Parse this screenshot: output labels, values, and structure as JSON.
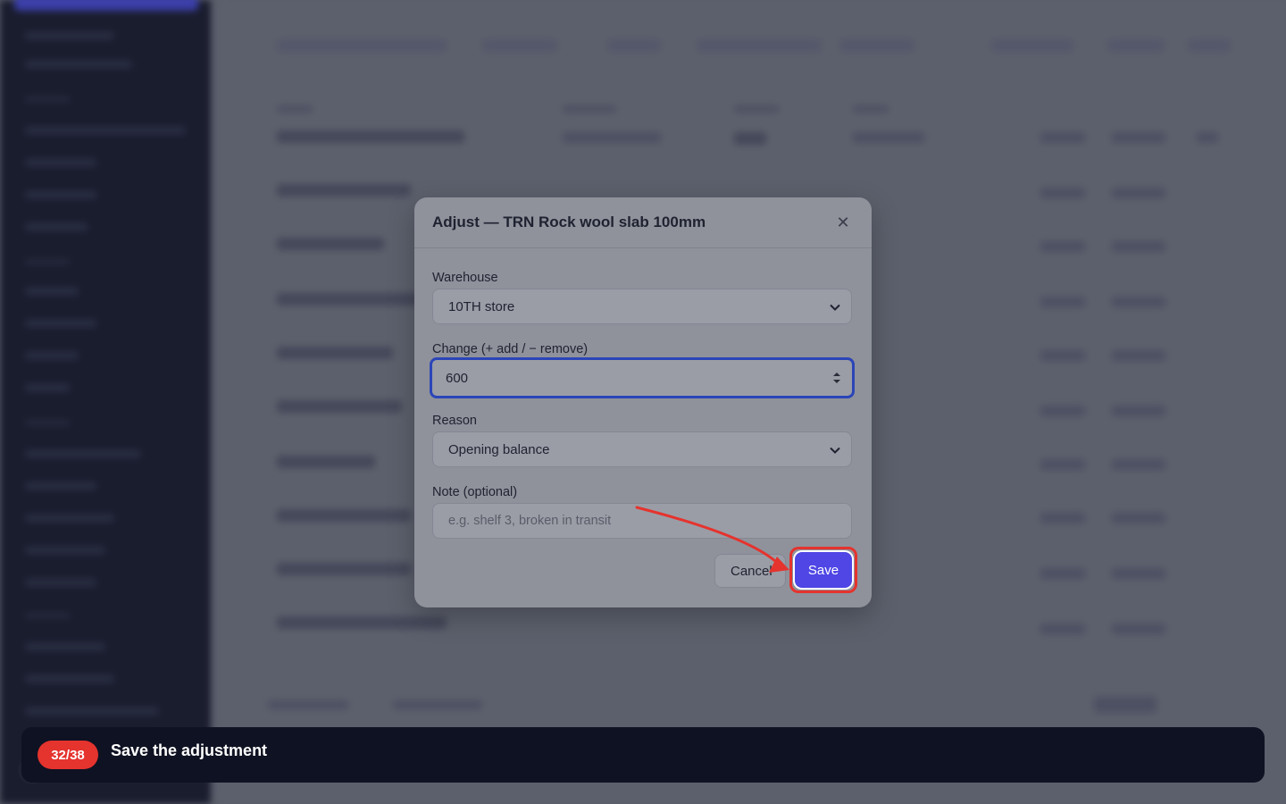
{
  "modal": {
    "title": "Adjust — TRN Rock wool slab 100mm",
    "warehouse_label": "Warehouse",
    "warehouse_value": "10TH store",
    "change_label": "Change (+ add / − remove)",
    "change_value": "600",
    "reason_label": "Reason",
    "reason_value": "Opening balance",
    "note_label": "Note (optional)",
    "note_placeholder": "e.g. shelf 3, broken in transit",
    "cancel_label": "Cancel",
    "save_label": "Save"
  },
  "tutorial": {
    "step": "32/38",
    "instruction": "Save the adjustment"
  },
  "colors": {
    "primary": "#4f46e5",
    "highlight": "#e5332e",
    "banner": "#0f1222"
  },
  "icons": {
    "close": "close-icon",
    "chevron": "chevron-down-icon",
    "stepper": "stepper-icon",
    "pointer": "arrow-pointer"
  }
}
